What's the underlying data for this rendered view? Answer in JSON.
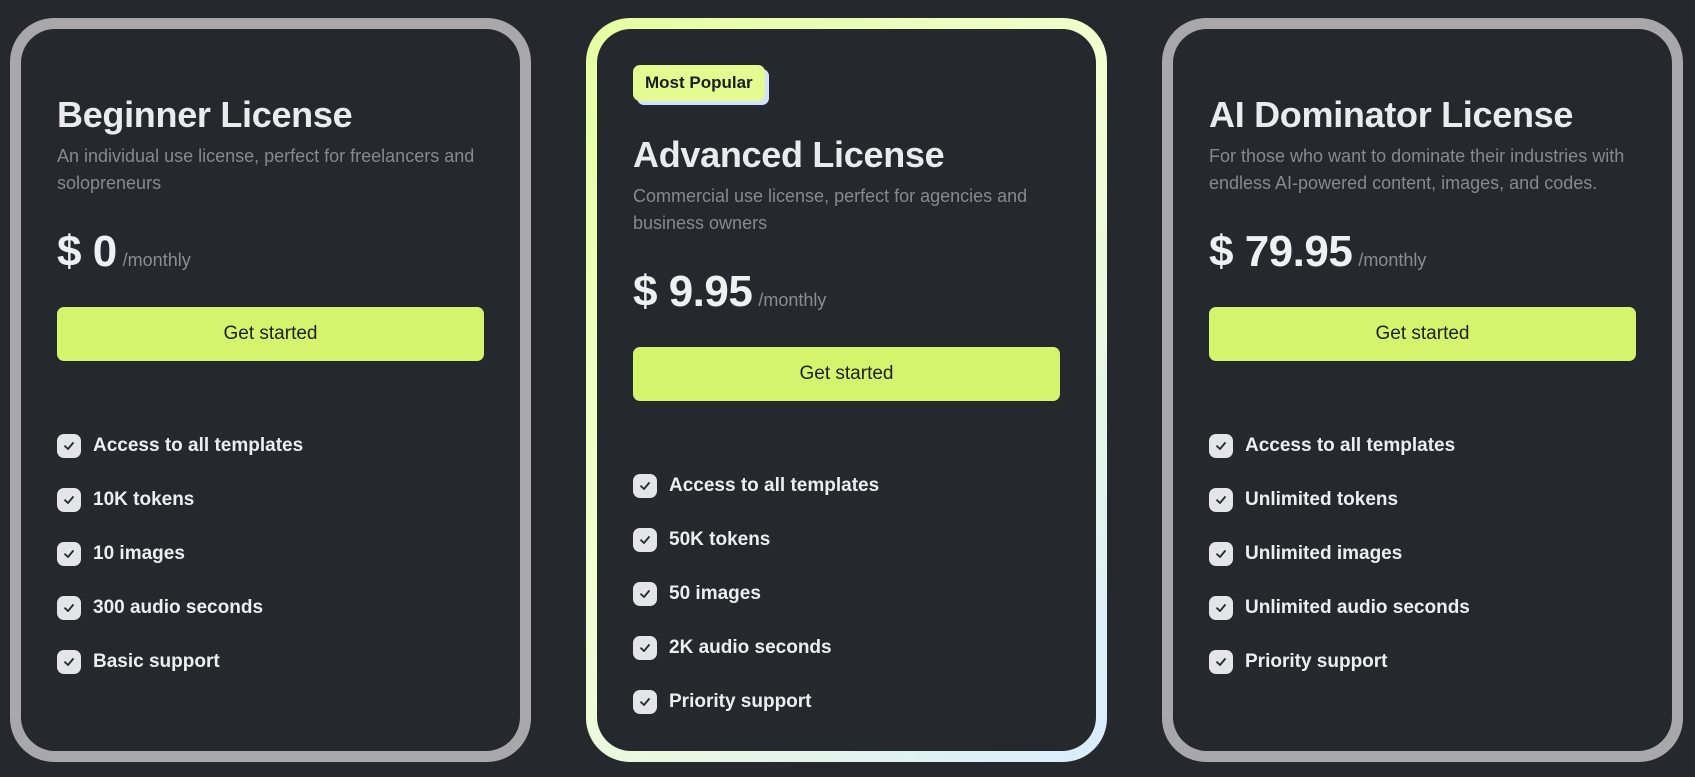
{
  "plans": [
    {
      "title": "Beginner License",
      "description": "An individual use license, perfect for freelancers and solopreneurs",
      "price": "$ 0",
      "period": "/monthly",
      "cta_label": "Get started",
      "features": [
        "Access to all templates",
        "10K tokens",
        "10 images",
        "300 audio seconds",
        "Basic support"
      ]
    },
    {
      "badge": "Most Popular",
      "title": "Advanced License",
      "description": "Commercial use license, perfect for agencies and business owners",
      "price": "$ 9.95",
      "period": "/monthly",
      "cta_label": "Get started",
      "features": [
        "Access to all templates",
        "50K tokens",
        "50 images",
        "2K audio seconds",
        "Priority support"
      ]
    },
    {
      "title": "AI Dominator License",
      "description": "For those who want to dominate their industries with endless AI-powered content, images, and codes.",
      "price": "$ 79.95",
      "period": "/monthly",
      "cta_label": "Get started",
      "features": [
        "Access to all templates",
        "Unlimited tokens",
        "Unlimited images",
        "Unlimited audio seconds",
        "Priority support"
      ]
    }
  ],
  "icons": {
    "feature_check": "check-icon"
  },
  "colors": {
    "background": "#25282d",
    "accent": "#d4f46d",
    "card_border": "#a8a8aa",
    "badge": "#e4fb92"
  }
}
